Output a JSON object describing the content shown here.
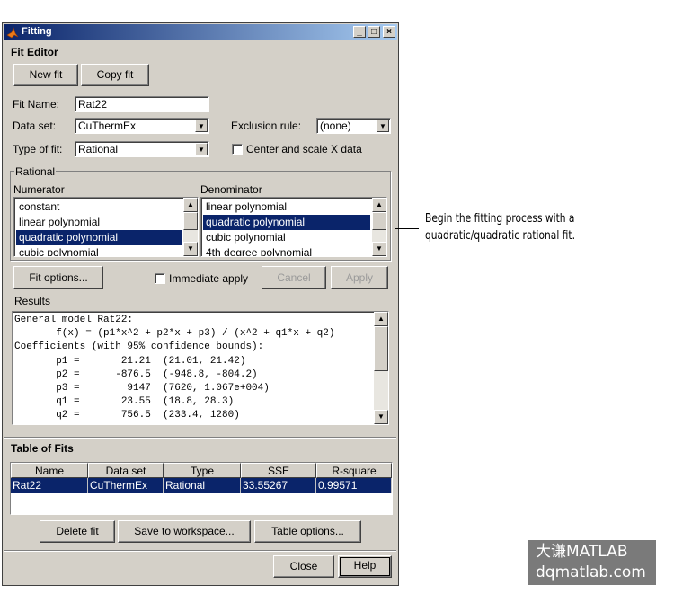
{
  "window": {
    "title": "Fitting",
    "controls": {
      "minimize": "_",
      "maximize": "□",
      "close": "×"
    }
  },
  "fit_editor": {
    "heading": "Fit Editor",
    "new_fit_label": "New fit",
    "copy_fit_label": "Copy fit",
    "fit_name_label": "Fit Name:",
    "fit_name_value": "Rat22",
    "data_set_label": "Data set:",
    "data_set_value": "CuThermEx",
    "exclusion_rule_label": "Exclusion rule:",
    "exclusion_rule_value": "(none)",
    "type_of_fit_label": "Type of fit:",
    "type_of_fit_value": "Rational",
    "center_scale_label": "Center and scale X data"
  },
  "rational": {
    "group_label": "Rational",
    "numerator_label": "Numerator",
    "numerator_items": [
      "constant",
      "linear polynomial",
      "quadratic polynomial",
      "cubic polynomial"
    ],
    "numerator_selected_index": 2,
    "denominator_label": "Denominator",
    "denominator_items": [
      "linear polynomial",
      "quadratic polynomial",
      "cubic polynomial",
      "4th degree polynomial"
    ],
    "denominator_selected_index": 1
  },
  "options": {
    "fit_options_label": "Fit options...",
    "immediate_apply_label": "Immediate apply",
    "cancel_label": "Cancel",
    "apply_label": "Apply"
  },
  "results": {
    "label": "Results",
    "lines": [
      "General model Rat22:",
      "       f(x) = (p1*x^2 + p2*x + p3) / (x^2 + q1*x + q2)",
      "Coefficients (with 95% confidence bounds):",
      "       p1 =       21.21  (21.01, 21.42)",
      "       p2 =      -876.5  (-948.8, -804.2)",
      "       p3 =        9147  (7620, 1.067e+004)",
      "       q1 =       23.55  (18.8, 28.3)",
      "       q2 =       756.5  (233.4, 1280)"
    ]
  },
  "table_of_fits": {
    "heading": "Table of Fits",
    "columns": [
      "Name",
      "Data set",
      "Type",
      "SSE",
      "R-square"
    ],
    "rows": [
      [
        "Rat22",
        "CuThermEx",
        "Rational",
        "33.55267",
        "0.99571"
      ]
    ],
    "delete_fit_label": "Delete fit",
    "save_workspace_label": "Save to workspace...",
    "table_options_label": "Table options..."
  },
  "footer": {
    "close_label": "Close",
    "help_label": "Help"
  },
  "annotation": {
    "line1": "Begin the fitting process with a",
    "line2": "quadratic/quadratic rational fit."
  },
  "watermark": {
    "line1": "大谦MATLAB",
    "line2": "dqmatlab.com"
  },
  "colors": {
    "selection": "#0a246a",
    "title_start": "#0a246a",
    "title_end": "#a6caf0",
    "face": "#d4d0c8"
  }
}
